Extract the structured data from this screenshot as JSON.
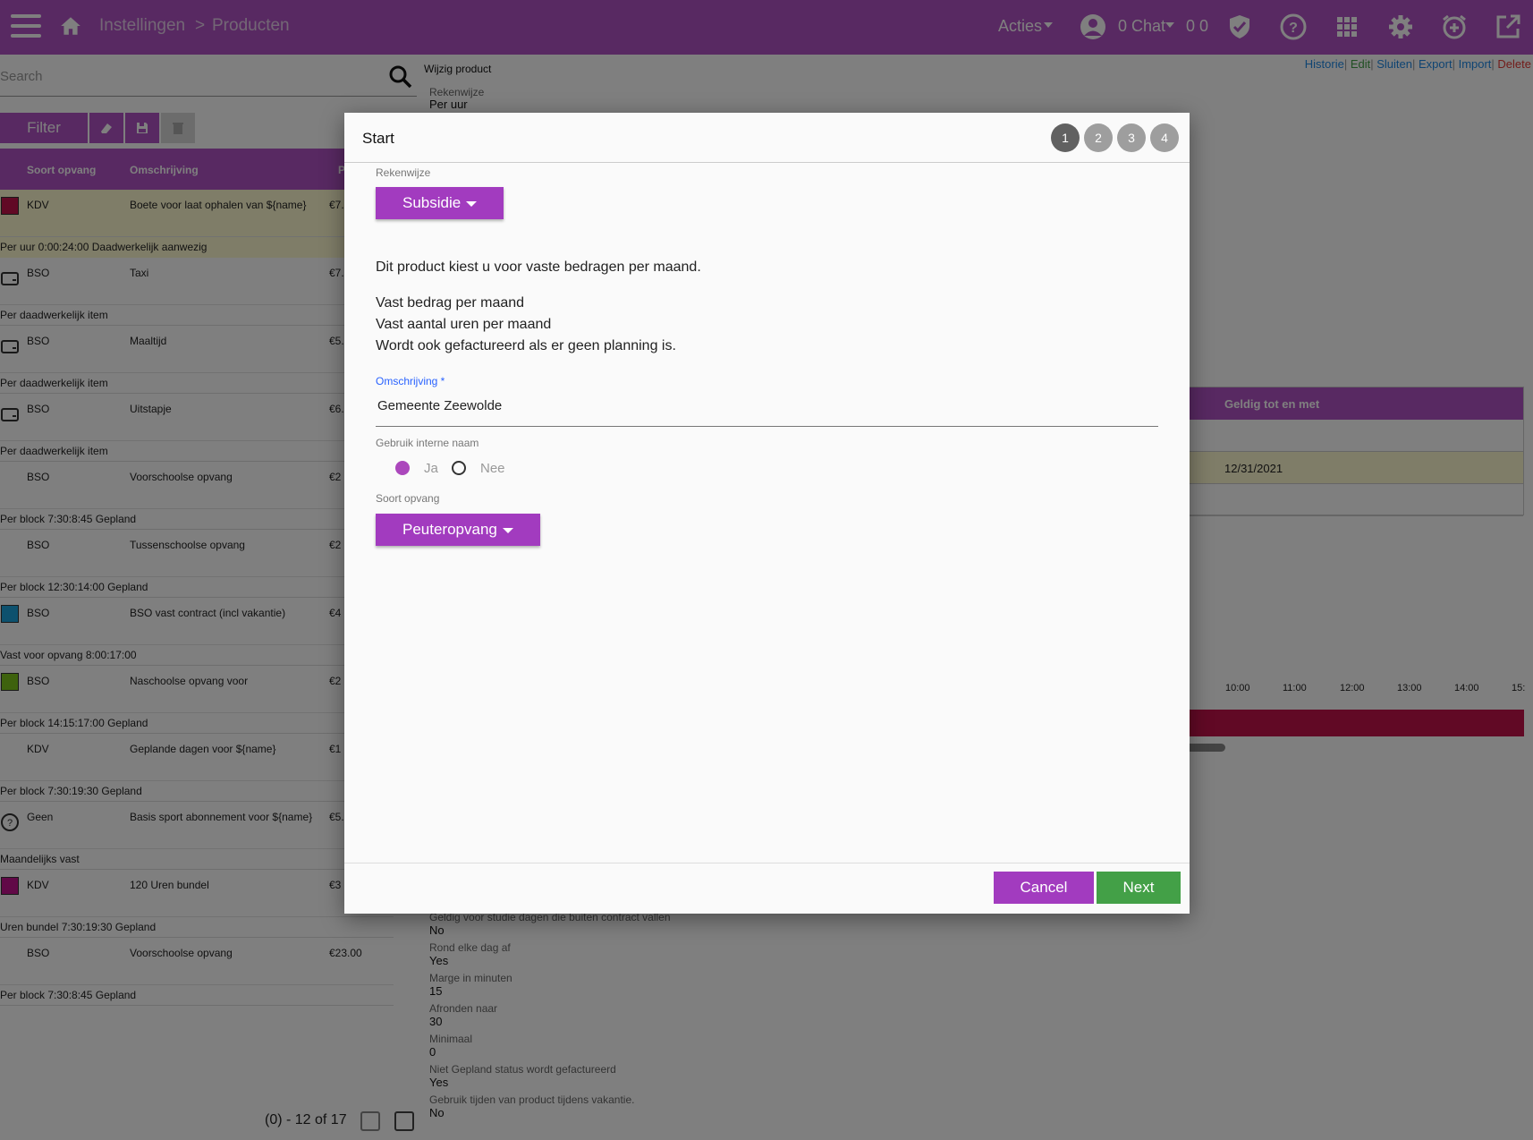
{
  "topbar": {
    "breadcrumb_1": "Instellingen",
    "breadcrumb_sep": ">",
    "breadcrumb_2": "Producten",
    "actions_label": "Acties",
    "chat_label": "0 Chat",
    "chat_counts": "0 0"
  },
  "search": {
    "placeholder": "Search"
  },
  "filter": {
    "label": "Filter"
  },
  "table": {
    "headers": [
      "Soort opvang",
      "Omschrijving",
      "P"
    ],
    "rows": [
      {
        "soort": "KDV",
        "omschrijving": "Boete voor laat ophalen van ${name}",
        "prijs": "€7.",
        "sub": "Per uur 0:00:24:00 Daadwerkelijk aanwezig"
      },
      {
        "soort": "BSO",
        "omschrijving": "Taxi",
        "prijs": "€7.",
        "sub": "Per daadwerkelijk item"
      },
      {
        "soort": "BSO",
        "omschrijving": "Maaltijd",
        "prijs": "€5.",
        "sub": "Per daadwerkelijk item"
      },
      {
        "soort": "BSO",
        "omschrijving": "Uitstapje",
        "prijs": "€6.",
        "sub": "Per daadwerkelijk item"
      },
      {
        "soort": "BSO",
        "omschrijving": "Voorschoolse opvang",
        "prijs": "€2",
        "sub": "Per block 7:30:8:45 Gepland"
      },
      {
        "soort": "BSO",
        "omschrijving": "Tussenschoolse opvang",
        "prijs": "€2",
        "sub": "Per block 12:30:14:00 Gepland"
      },
      {
        "soort": "BSO",
        "omschrijving": "BSO vast contract (incl vakantie)",
        "prijs": "€4",
        "sub": "Vast voor opvang 8:00:17:00"
      },
      {
        "soort": "BSO",
        "omschrijving": "Naschoolse opvang voor",
        "prijs": "€2",
        "sub": "Per block 14:15:17:00 Gepland"
      },
      {
        "soort": "KDV",
        "omschrijving": "Geplande dagen voor ${name}",
        "prijs": "€1",
        "sub": "Per block 7:30:19:30 Gepland"
      },
      {
        "soort": "Geen",
        "omschrijving": "Basis sport abonnement voor ${name}",
        "prijs": "€5.",
        "sub": "Maandelijks vast"
      },
      {
        "soort": "KDV",
        "omschrijving": "120 Uren bundel",
        "prijs": "€3",
        "sub": "Uren bundel 7:30:19:30 Gepland"
      },
      {
        "soort": "BSO",
        "omschrijving": "Voorschoolse opvang",
        "prijs": "€23.00",
        "sub": "Per block 7:30:8:45 Gepland"
      }
    ]
  },
  "pager": {
    "text": "(0) - 12 of 17"
  },
  "actions": {
    "historie": "Historie",
    "edit": "Edit",
    "sluiten": "Sluiten",
    "export": "Export",
    "import": "Import",
    "delete": "Delete"
  },
  "detail": {
    "heading": "Wijzig product",
    "rekenwijze_label": "Rekenwijze",
    "rekenwijze_value": "Per uur",
    "fields": [
      {
        "label": "Geldig voor studie dagen die buiten contract vallen",
        "value": "No"
      },
      {
        "label": "Rond elke dag af",
        "value": "Yes"
      },
      {
        "label": "Marge in minuten",
        "value": "15"
      },
      {
        "label": "Afronden naar",
        "value": "30"
      },
      {
        "label": "Minimaal",
        "value": "0"
      },
      {
        "label": "Niet Gepland status wordt gefactureerd",
        "value": "Yes"
      },
      {
        "label": "Gebruik tijden van product tijdens vakantie.",
        "value": "No"
      }
    ]
  },
  "geldig_table": {
    "header": "Geldig tot en met",
    "row2": "12/31/2021"
  },
  "timeline": {
    "ticks": [
      "10:00",
      "11:00",
      "12:00",
      "13:00",
      "14:00",
      "15:"
    ]
  },
  "modal": {
    "title": "Start",
    "steps": [
      "1",
      "2",
      "3",
      "4"
    ],
    "rekenwijze_label": "Rekenwijze",
    "rekenwijze_value": "Subsidie",
    "description": "Dit product kiest u voor vaste bedragen per maand.",
    "bullets": [
      "Vast bedrag per maand",
      "Vast aantal uren per maand",
      "Wordt ook gefactureerd als er geen planning is."
    ],
    "omschrijving_label": "Omschrijving *",
    "omschrijving_value": "Gemeente Zeewolde",
    "interne_naam_label": "Gebruik interne naam",
    "radio_ja": "Ja",
    "radio_nee": "Nee",
    "soort_label": "Soort opvang",
    "soort_value": "Peuteropvang",
    "cancel": "Cancel",
    "next": "Next"
  },
  "colors": {
    "brand": "#b153c4",
    "button": "#a23bbf",
    "next": "#43a047",
    "highlight_row": "#fffad1",
    "timeline_bar": "#c2134a"
  }
}
